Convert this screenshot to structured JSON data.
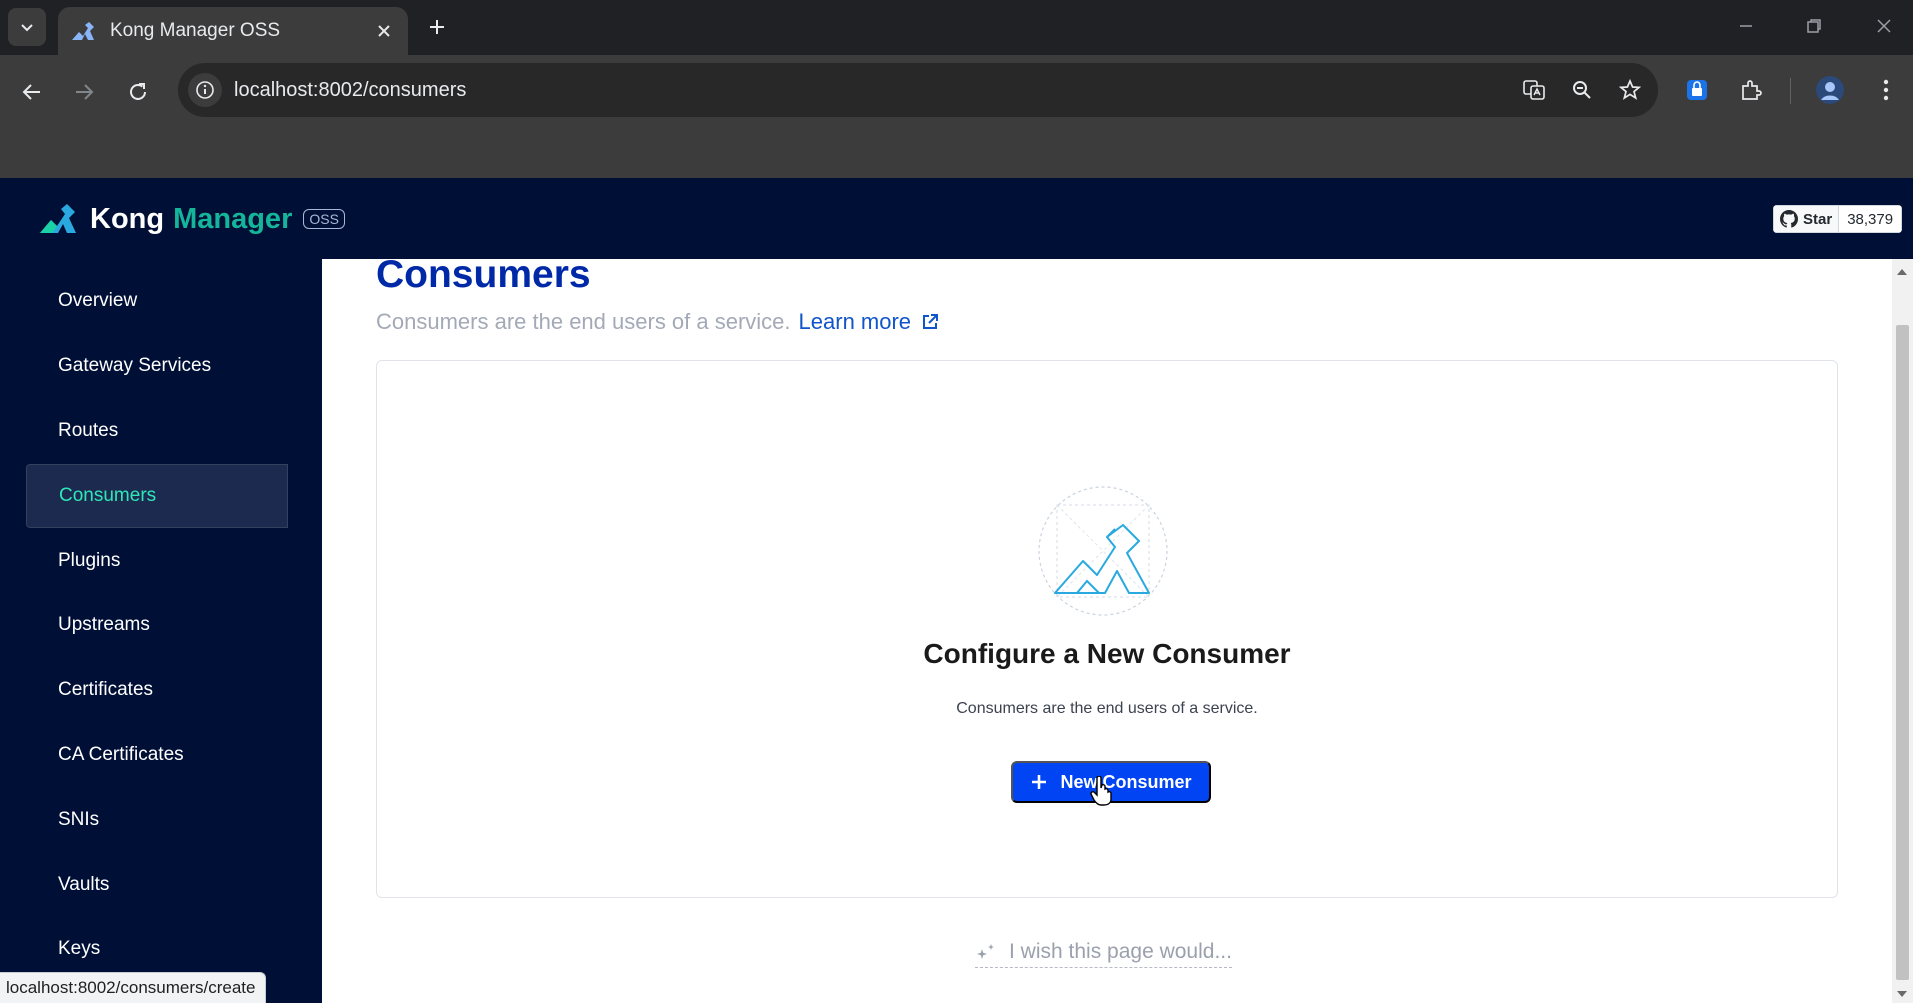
{
  "browser": {
    "tab_title": "Kong Manager OSS",
    "url": "localhost:8002/consumers",
    "status_url": "localhost:8002/consumers/create"
  },
  "header": {
    "logo_kong": "Kong",
    "logo_manager": "Manager",
    "logo_badge": "OSS",
    "github_star_label": "Star",
    "github_star_count": "38,379"
  },
  "sidebar": {
    "items": [
      {
        "label": "Overview"
      },
      {
        "label": "Gateway Services"
      },
      {
        "label": "Routes"
      },
      {
        "label": "Consumers",
        "active": true
      },
      {
        "label": "Plugins"
      },
      {
        "label": "Upstreams"
      },
      {
        "label": "Certificates"
      },
      {
        "label": "CA Certificates"
      },
      {
        "label": "SNIs"
      },
      {
        "label": "Vaults"
      },
      {
        "label": "Keys"
      }
    ]
  },
  "main": {
    "title": "Consumers",
    "subtitle": "Consumers are the end users of a service.",
    "learn_more": "Learn more",
    "empty_state": {
      "title": "Configure a New Consumer",
      "description": "Consumers are the end users of a service.",
      "button_label": "New Consumer"
    },
    "feedback_label": "I wish this page would..."
  },
  "colors": {
    "nav_bg": "#000f35",
    "accent_green": "#2ee6b8",
    "primary_blue": "#0044f4",
    "title_blue": "#0029a8"
  }
}
